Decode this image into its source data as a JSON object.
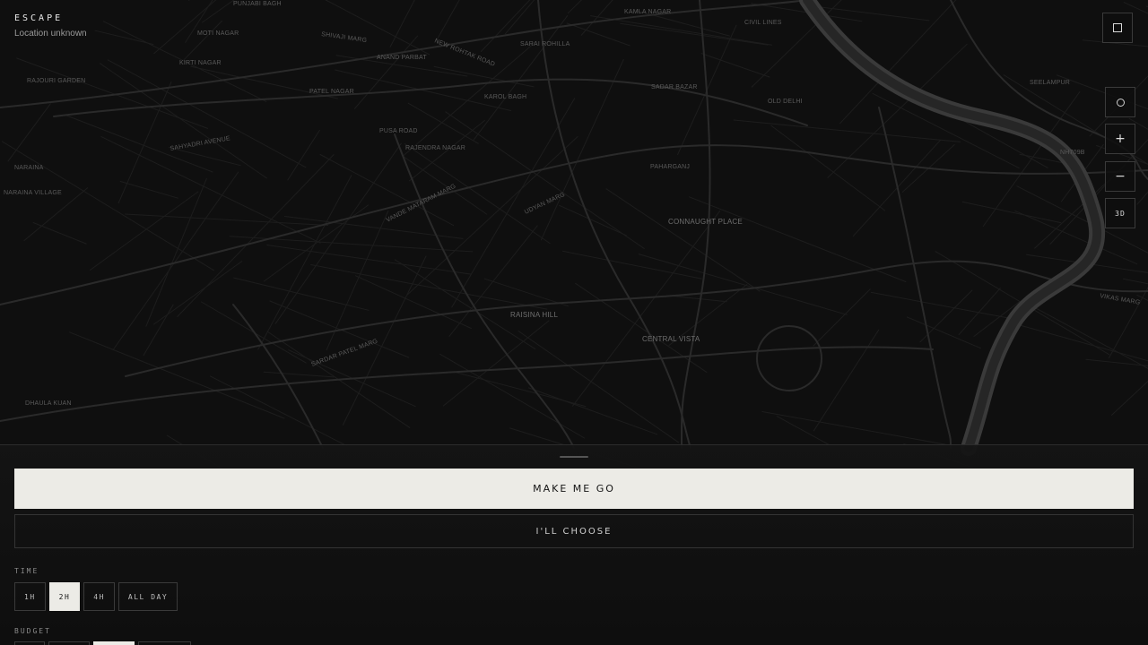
{
  "brand": {
    "title": "ESCAPE",
    "subtitle": "Location unknown"
  },
  "map": {
    "labels": [
      {
        "text": "PUNJABI BAGH"
      },
      {
        "text": "KAMLA NAGAR"
      },
      {
        "text": "CIVIL LINES"
      },
      {
        "text": "MOTI NAGAR"
      },
      {
        "text": "SHIVAJI MARG"
      },
      {
        "text": "NEW ROHTAK ROAD"
      },
      {
        "text": "SARAI ROHILLA"
      },
      {
        "text": "KIRTI NAGAR"
      },
      {
        "text": "ANAND PARBAT"
      },
      {
        "text": "RAJOURI GARDEN"
      },
      {
        "text": "PATEL NAGAR"
      },
      {
        "text": "KAROL BAGH"
      },
      {
        "text": "SADAR BAZAR"
      },
      {
        "text": "OLD DELHI"
      },
      {
        "text": "SEELAMPUR"
      },
      {
        "text": "PUSA ROAD"
      },
      {
        "text": "RAJENDRA NAGAR"
      },
      {
        "text": "SAHYADRI AVENUE"
      },
      {
        "text": "PAHARGANJ"
      },
      {
        "text": "NARAINA"
      },
      {
        "text": "NARAINA VILLAGE"
      },
      {
        "text": "VANDE MATARAM MARG"
      },
      {
        "text": "UDYAN MARG"
      },
      {
        "text": "CONNAUGHT PLACE"
      },
      {
        "text": "RAISINA HILL"
      },
      {
        "text": "CENTRAL VISTA"
      },
      {
        "text": "SARDAR PATEL MARG"
      },
      {
        "text": "DHAULA KUAN"
      },
      {
        "text": "VIKAS MARG"
      },
      {
        "text": "NH709B"
      }
    ]
  },
  "controls": {
    "three_d_label": "3D",
    "zoom_in_label": "+",
    "zoom_out_label": "−"
  },
  "panel": {
    "primary_button": "MAKE ME GO",
    "secondary_button": "I'LL CHOOSE",
    "time": {
      "label": "TIME",
      "options": [
        "1H",
        "2H",
        "4H",
        "ALL DAY"
      ],
      "selected": "2H"
    },
    "budget": {
      "label": "BUDGET"
    }
  },
  "colors": {
    "background": "#0e0e0e",
    "road": "#2a2a2a",
    "river": "#3a3a3a",
    "accent_light": "#ecebe6"
  }
}
